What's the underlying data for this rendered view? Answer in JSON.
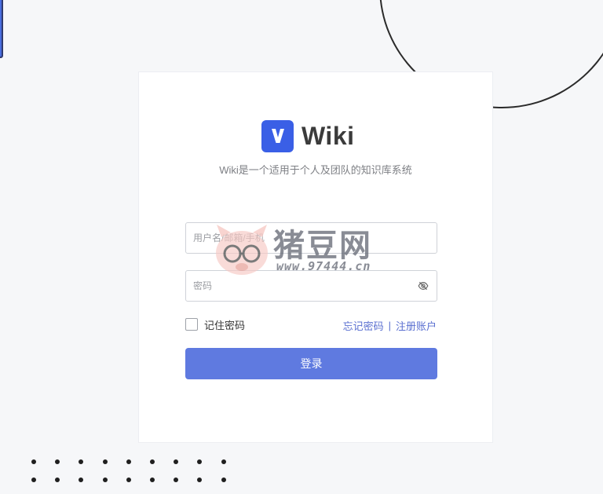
{
  "brand": {
    "name": "Wiki",
    "logo_icon": "v-logo-icon",
    "logo_color": "#3a5fe6"
  },
  "subtitle": "Wiki是一个适用于个人及团队的知识库系统",
  "form": {
    "username_placeholder": "用户名/邮箱/手机",
    "password_placeholder": "密码",
    "password_toggle_icon": "eye-icon",
    "remember_label": "记住密码",
    "forgot_link": "忘记密码",
    "separator": "|",
    "register_link": "注册账户",
    "login_button": "登录",
    "accent_color": "#5f7ae0"
  },
  "watermark": {
    "name": "猪豆网",
    "url": "www.97444.cn"
  }
}
